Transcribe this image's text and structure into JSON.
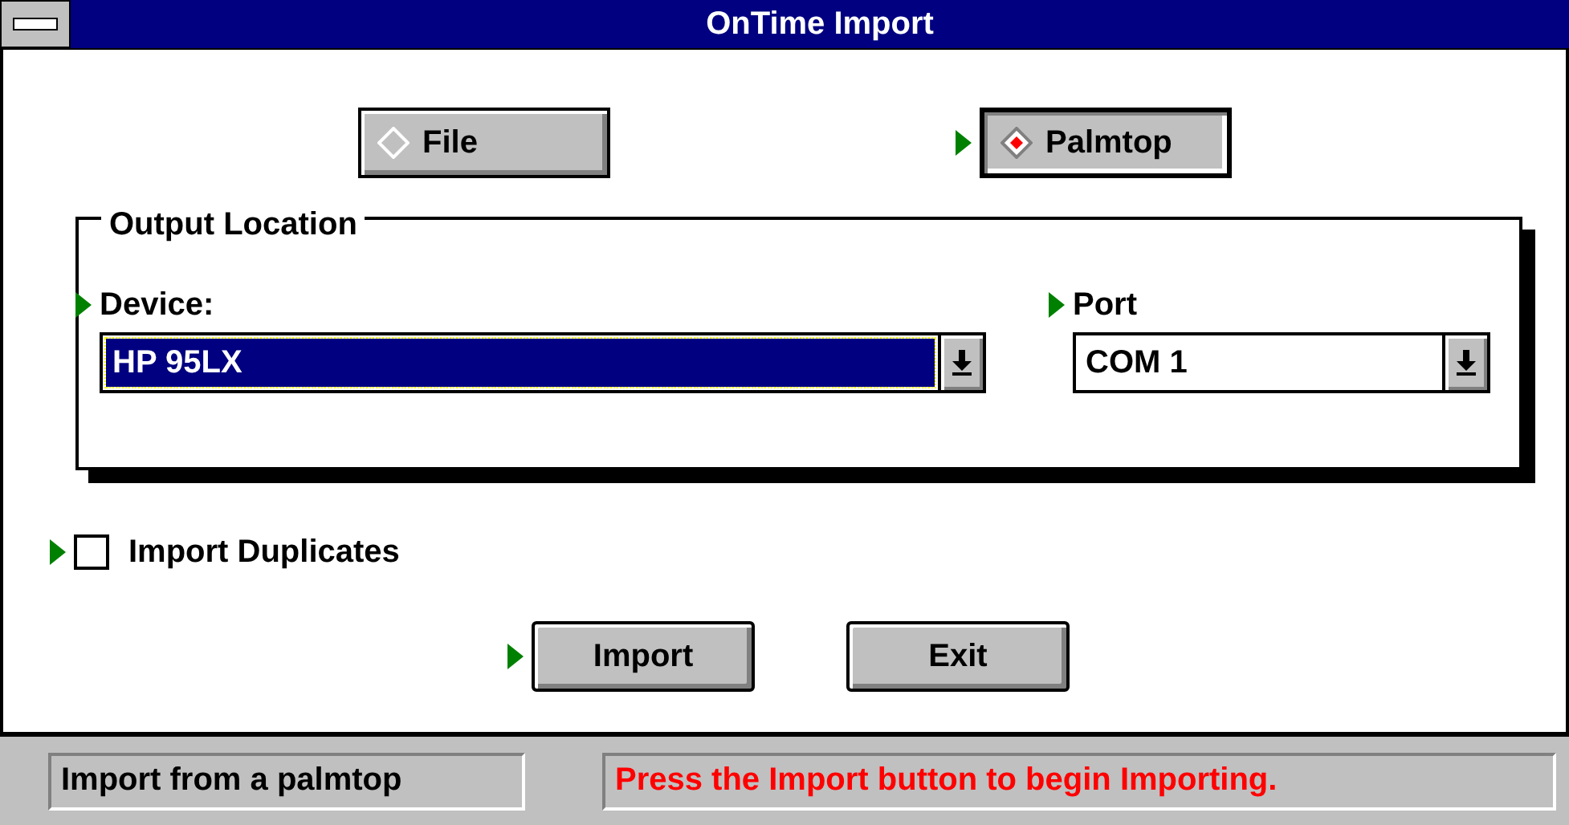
{
  "window": {
    "title": "OnTime Import"
  },
  "source_options": [
    {
      "label": "File",
      "selected": false,
      "pointer": false
    },
    {
      "label": "Palmtop",
      "selected": true,
      "pointer": true
    }
  ],
  "output_location": {
    "title": "Output Location",
    "device": {
      "label": "Device:",
      "value": "HP 95LX",
      "focused": true,
      "pointer": true
    },
    "port": {
      "label": "Port",
      "value": "COM 1",
      "focused": false,
      "pointer": true
    }
  },
  "import_duplicates": {
    "label": "Import Duplicates",
    "checked": false,
    "pointer": true
  },
  "buttons": [
    {
      "label": "Import",
      "pointer": true
    },
    {
      "label": "Exit",
      "pointer": false
    }
  ],
  "status_bar": {
    "mode": "Import from a palmtop",
    "message": "Press the Import button to begin Importing."
  }
}
